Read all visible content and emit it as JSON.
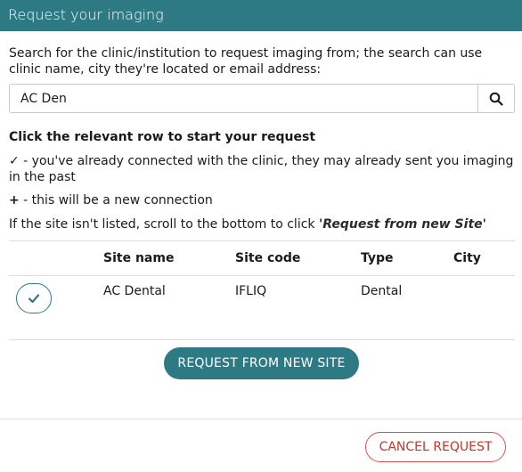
{
  "header": {
    "title": "Request your imaging"
  },
  "intro": "Search for the clinic/institution to request imaging from; the search can use clinic name, city they're located or email address:",
  "search": {
    "value": "AC Den",
    "icon": "search-icon"
  },
  "instructions": {
    "title": "Click the relevant row to start your request",
    "check_symbol": "✓",
    "check_text": " - you've already connected with the clinic, they may already sent you imaging in the past",
    "plus_symbol": "+",
    "plus_text": " - this will be a new connection",
    "new_site_prefix": "If the site isn't listed, scroll to the bottom to click ",
    "new_site_link": "'Request from new Site'"
  },
  "table": {
    "columns": [
      "Site name",
      "Site code",
      "Type",
      "City"
    ],
    "rows": [
      {
        "status": "connected",
        "site_name": "AC Dental",
        "site_code": "IFLIQ",
        "type": "Dental",
        "city": ""
      }
    ]
  },
  "buttons": {
    "request_new_site": "REQUEST FROM NEW SITE",
    "cancel": "CANCEL REQUEST"
  },
  "colors": {
    "accent": "#2d7a84",
    "danger": "#d4504a"
  }
}
